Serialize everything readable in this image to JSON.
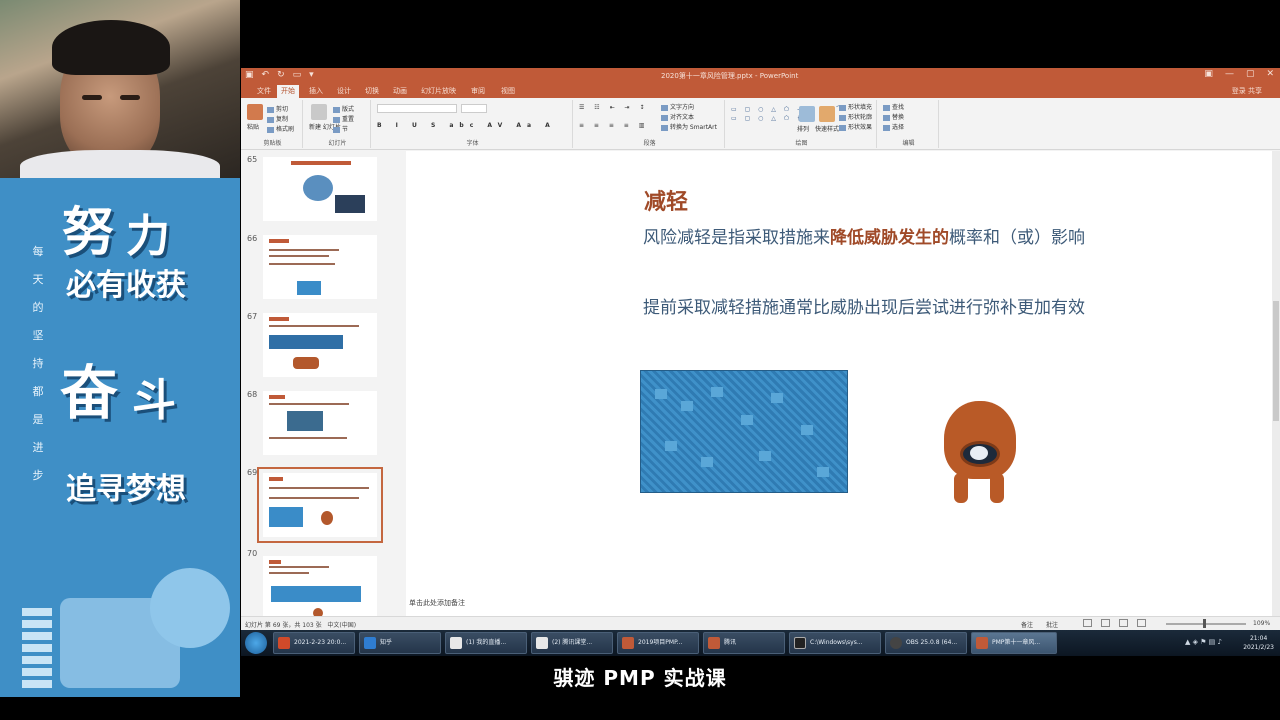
{
  "overlay": {
    "slogan": [
      "努",
      "力",
      "必有收获",
      "奋",
      "斗",
      "追寻梦想"
    ],
    "side_words": [
      "每",
      "天",
      "的",
      "坚",
      "持",
      "都",
      "是",
      "进",
      "步"
    ],
    "caption": "骐迹 PMP 实战课"
  },
  "ppt": {
    "title": "2020第十一章风险管理.pptx - PowerPoint",
    "tabs": [
      "文件",
      "开始",
      "插入",
      "设计",
      "切换",
      "动画",
      "幻灯片放映",
      "审阅",
      "视图"
    ],
    "active_tab": "开始",
    "tabs_right": "登录  共享",
    "ribbon_groups": [
      "剪贴板",
      "幻灯片",
      "字体",
      "段落",
      "绘图",
      "编辑"
    ],
    "ribbon_items": {
      "paste": "粘贴",
      "cut": "剪切",
      "copy": "复制",
      "format_painter": "格式刷",
      "new_slide": "新建\n幻灯片",
      "layout": "版式",
      "reset": "重置",
      "section": "节",
      "text_direction": "文字方向",
      "align_text": "对齐文本",
      "convert_smartart": "转换为 SmartArt",
      "arrange": "排列",
      "quick_styles": "快速样式",
      "shape_fill": "形状填充",
      "shape_outline": "形状轮廓",
      "shape_effects": "形状效果",
      "find": "查找",
      "replace": "替换",
      "select": "选择"
    },
    "thumbnails": [
      {
        "num": "65",
        "selected": false
      },
      {
        "num": "66",
        "selected": false
      },
      {
        "num": "67",
        "selected": false
      },
      {
        "num": "68",
        "selected": false
      },
      {
        "num": "69",
        "selected": true
      },
      {
        "num": "70",
        "selected": false
      }
    ],
    "slide": {
      "title": "减轻",
      "p1_prefix": "风险减轻是指采取措施来",
      "p1_highlight": "降低威胁发生的",
      "p1_suffix": "概率和（或）影响",
      "p2": "提前采取减轻措施通常比威胁出现后尝试进行弥补更加有效"
    },
    "notes_placeholder": "单击此处添加备注",
    "status": {
      "slide_info": "幻灯片 第 69 张，共 103 张",
      "language": "中文(中国)",
      "notes": "备注",
      "comments": "批注",
      "zoom": "109%"
    }
  },
  "taskbar": {
    "tasks": [
      {
        "label": "2021-2-23 20:0...",
        "color": "#d04a2a"
      },
      {
        "label": "知乎",
        "color": "#2f7dd1"
      },
      {
        "label": "(1) 我的直播...",
        "color": "#e8e8e8"
      },
      {
        "label": "(2) 腾讯课堂...",
        "color": "#e8e8e8"
      },
      {
        "label": "2019项目PMP...",
        "color": "#c05a38"
      },
      {
        "label": "腾讯",
        "color": "#c05a38"
      },
      {
        "label": "C:\\Windows\\sys...",
        "color": "#222"
      },
      {
        "label": "OBS 25.0.8 (64...",
        "color": "#444"
      },
      {
        "label": "PMP第十一章风...",
        "color": "#c05a38"
      }
    ],
    "time": "21:04",
    "date": "2021/2/23"
  }
}
